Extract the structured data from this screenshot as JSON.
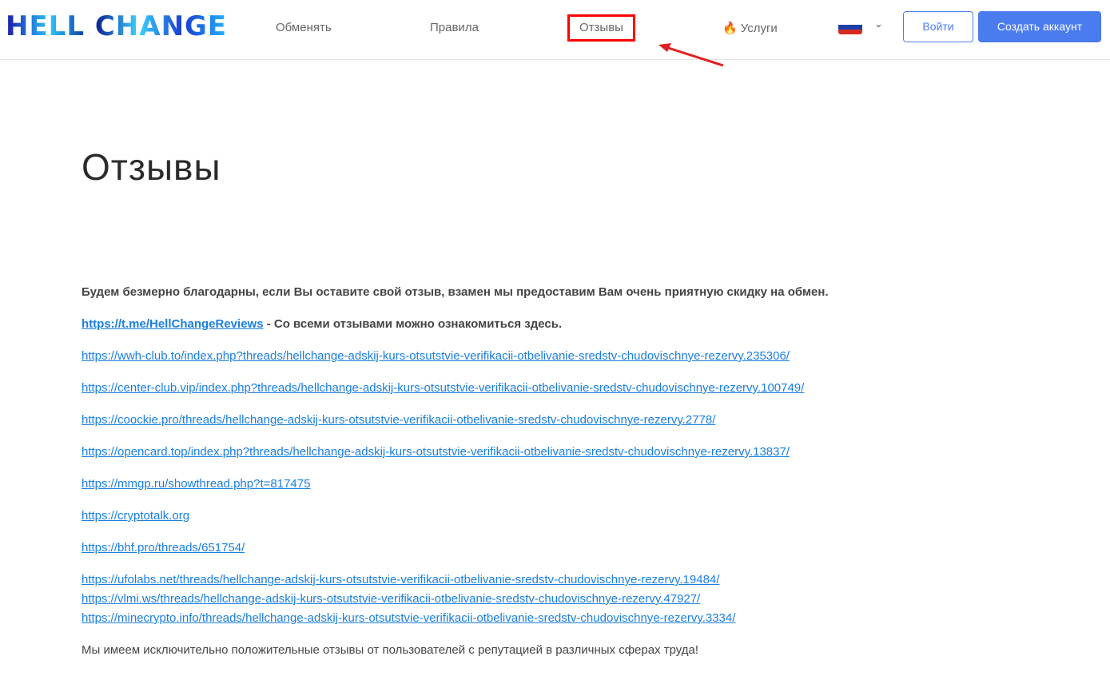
{
  "header": {
    "logo_text": "HELL CHANGE",
    "nav": [
      "Обменять",
      "Правила",
      "Отзывы",
      "Услуги"
    ],
    "services_icon": "fire-icon",
    "language_flag": "russia-flag-icon",
    "login_label": "Войти",
    "signup_label": "Создать аккаунт",
    "accent_color": "#4a7cf0"
  },
  "main": {
    "title": "Отзывы",
    "intro": "Будем безмерно благодарны, если Вы оставите свой отзыв, взамен мы предоставим Вам очень приятную скидку на обмен.",
    "telegram_link": "https://t.me/HellChangeReviews",
    "telegram_text": " - Со всеми отзывами можно ознакомиться здесь.",
    "links": [
      "https://wwh-club.to/index.php?threads/hellchange-adskij-kurs-otsutstvie-verifikacii-otbelivanie-sredstv-chudovischnye-rezervy.235306/",
      "https://center-club.vip/index.php?threads/hellchange-adskij-kurs-otsutstvie-verifikacii-otbelivanie-sredstv-chudovischnye-rezervy.100749/",
      "https://coockie.pro/threads/hellchange-adskij-kurs-otsutstvie-verifikacii-otbelivanie-sredstv-chudovischnye-rezervy.2778/",
      "https://opencard.top/index.php?threads/hellchange-adskij-kurs-otsutstvie-verifikacii-otbelivanie-sredstv-chudovischnye-rezervy.13837/",
      "https://mmgp.ru/showthread.php?t=817475",
      "https://cryptotalk.org",
      "https://bhf.pro/threads/651754/",
      "https://ufolabs.net/threads/hellchange-adskij-kurs-otsutstvie-verifikacii-otbelivanie-sredstv-chudovischnye-rezervy.19484/",
      "https://vlmi.ws/threads/hellchange-adskij-kurs-otsutstvie-verifikacii-otbelivanie-sredstv-chudovischnye-rezervy.47927/",
      "https://minecrypto.info/threads/hellchange-adskij-kurs-otsutstvie-verifikacii-otbelivanie-sredstv-chudovischnye-rezervy.3334/"
    ],
    "outro": "Мы имеем исключительно положительные отзывы от пользователей с репутацией в различных сферах труда!"
  }
}
